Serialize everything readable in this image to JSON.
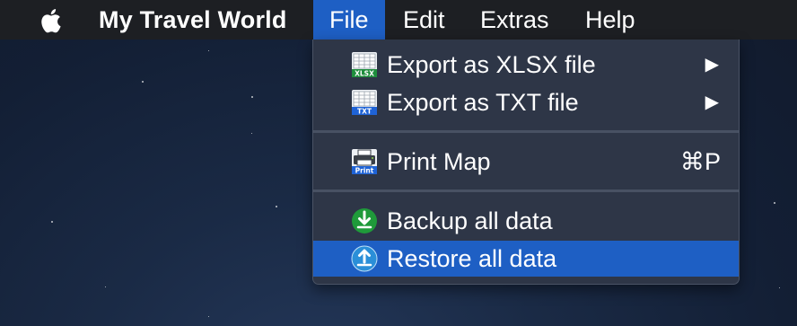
{
  "menubar": {
    "apple_icon": "apple-logo-icon",
    "app_name": "My Travel World",
    "menus": [
      "File",
      "Edit",
      "Extras",
      "Help"
    ],
    "active_menu": "File"
  },
  "file_menu": {
    "export_xlsx": {
      "label": "Export as XLSX file",
      "icon": "xlsx-file-icon",
      "icon_text": "XLSX",
      "submenu_indicator": "▶"
    },
    "export_txt": {
      "label": "Export as TXT file",
      "icon": "txt-file-icon",
      "icon_text": "TXT",
      "submenu_indicator": "▶"
    },
    "print_map": {
      "label": "Print Map",
      "icon": "printer-icon",
      "icon_text": "Print",
      "shortcut": "⌘P"
    },
    "backup": {
      "label": "Backup all data",
      "icon": "download-arrow-icon"
    },
    "restore": {
      "label": "Restore all data",
      "icon": "upload-arrow-icon",
      "highlighted": true
    }
  },
  "colors": {
    "menubar_bg": "#1d1f23",
    "accent": "#1e5fc4",
    "menu_bg": "#2e3647",
    "xlsx_green": "#1f8e3d",
    "txt_blue": "#1f63d6",
    "backup_green": "#1f9a3a",
    "restore_blue": "#2b8fd8"
  }
}
